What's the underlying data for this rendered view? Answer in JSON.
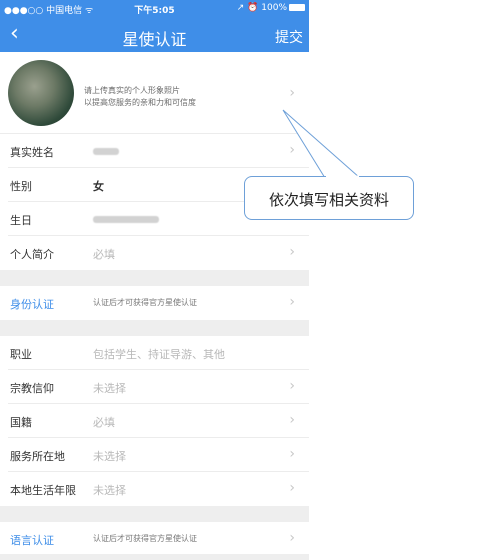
{
  "status_bar": {
    "carrier": "●●●○○ 中国电信 ᯤ",
    "time": "下午5:05",
    "battery": "↗ ⏰ 100%"
  },
  "nav": {
    "back_icon": "chevron-left-icon",
    "title": "星使认证",
    "submit": "提交"
  },
  "photo": {
    "hint_line1": "请上传真实的个人形象照片",
    "hint_line2": "以提高您服务的亲和力和可信度"
  },
  "rows": {
    "real_name": {
      "label": "真实姓名"
    },
    "gender": {
      "label": "性别",
      "value": "女"
    },
    "birthday": {
      "label": "生日"
    },
    "bio": {
      "label": "个人简介",
      "placeholder": "必填"
    },
    "identity": {
      "label": "身份认证",
      "note": "认证后才可获得官方星使认证"
    },
    "occupation": {
      "label": "职业",
      "placeholder": "包括学生、持证导游、其他"
    },
    "religion": {
      "label": "宗教信仰",
      "placeholder": "未选择"
    },
    "nationality": {
      "label": "国籍",
      "placeholder": "必填"
    },
    "service_location": {
      "label": "服务所在地",
      "placeholder": "未选择"
    },
    "local_years": {
      "label": "本地生活年限",
      "placeholder": "未选择"
    },
    "language": {
      "label": "语言认证",
      "note": "认证后才可获得官方星使认证"
    }
  },
  "callout": {
    "text": "依次填写相关资料"
  },
  "colors": {
    "accent": "#3f8ee8",
    "divider": "#eeeeee",
    "placeholder": "#b8b8b8"
  }
}
